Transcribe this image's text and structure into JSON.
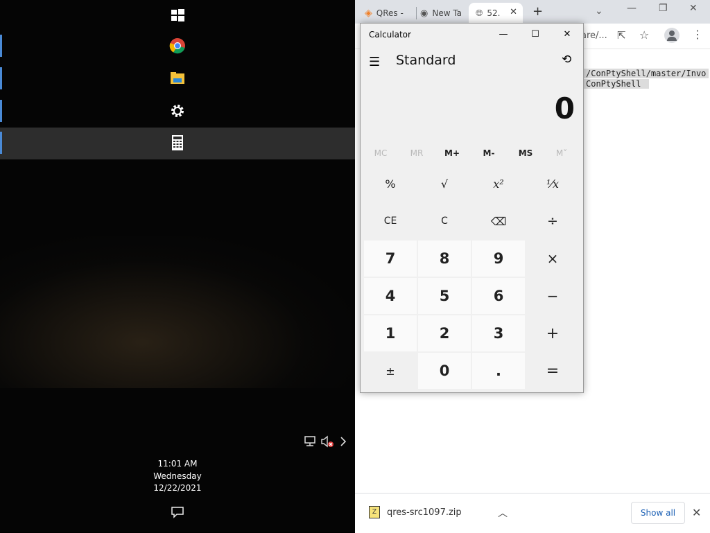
{
  "desktop": {
    "tray": {
      "network_icon": "network-icon",
      "volume_icon": "volume-muted-icon",
      "chevron_icon": "chevron-right-icon"
    },
    "clock": {
      "time": "11:01 AM",
      "day": "Wednesday",
      "date": "12/22/2021"
    },
    "sidebar_items": [
      {
        "name": "windows-icon",
        "active": false
      },
      {
        "name": "chrome-icon",
        "active": false
      },
      {
        "name": "file-explorer-icon",
        "active": false
      },
      {
        "name": "settings-gear-icon",
        "active": false
      },
      {
        "name": "calculator-icon",
        "active": true
      }
    ]
  },
  "browser": {
    "tabs": [
      {
        "label": "QRes -",
        "icon": "qres-icon"
      },
      {
        "label": "New Ta",
        "icon": "chrome-icon"
      },
      {
        "label": "52.",
        "icon": "globe-icon",
        "close": "✕"
      }
    ],
    "new_tab": "+",
    "address_fragment": "are/...",
    "page_lines": [
      "/ConPtyShell/master/Invo",
      "ConPtyShell "
    ],
    "downloads": {
      "file_name": "qres-src1097.zip",
      "show_all": "Show all"
    }
  },
  "calculator": {
    "title": "Calculator",
    "mode": "Standard",
    "display": "0",
    "memory": [
      {
        "label": "MC",
        "enabled": false
      },
      {
        "label": "MR",
        "enabled": false
      },
      {
        "label": "M+",
        "enabled": true
      },
      {
        "label": "M-",
        "enabled": true
      },
      {
        "label": "MS",
        "enabled": true
      },
      {
        "label": "M˅",
        "enabled": false
      }
    ],
    "keys": {
      "percent": "%",
      "sqrt": "√",
      "square": "x²",
      "reciprocal": "¹⁄x",
      "ce": "CE",
      "c": "C",
      "backspace": "⌫",
      "divide": "÷",
      "n7": "7",
      "n8": "8",
      "n9": "9",
      "multiply": "×",
      "n4": "4",
      "n5": "5",
      "n6": "6",
      "minus": "−",
      "n1": "1",
      "n2": "2",
      "n3": "3",
      "plus": "+",
      "negate": "±",
      "n0": "0",
      "decimal": ".",
      "equals": "="
    }
  }
}
